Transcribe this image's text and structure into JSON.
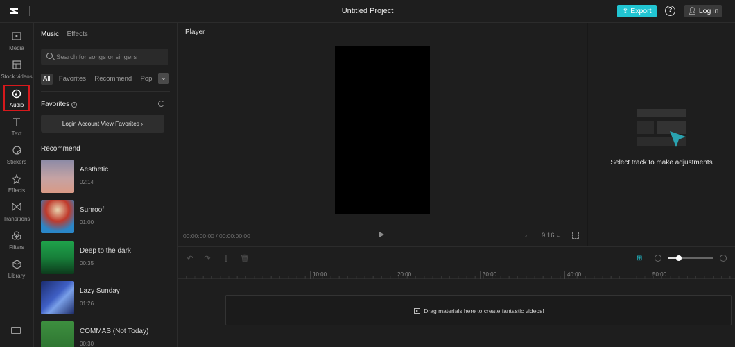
{
  "app": {
    "title": "Untitled Project",
    "logo": "capcut-logo",
    "export_label": "Export",
    "help_label": "?",
    "login_label": "Log in",
    "accent": "#21c5d2",
    "highlight": "#d6191c"
  },
  "sidebar": {
    "items": [
      {
        "label": "Media",
        "icon": "media-icon"
      },
      {
        "label": "Stock videos",
        "icon": "stock-videos-icon"
      },
      {
        "label": "Audio",
        "icon": "audio-icon",
        "active": true
      },
      {
        "label": "Text",
        "icon": "text-icon"
      },
      {
        "label": "Stickers",
        "icon": "stickers-icon"
      },
      {
        "label": "Effects",
        "icon": "effects-icon"
      },
      {
        "label": "Transitions",
        "icon": "transitions-icon"
      },
      {
        "label": "Filters",
        "icon": "filters-icon"
      },
      {
        "label": "Library",
        "icon": "library-icon"
      }
    ],
    "bottom_icon": "keyboard-shortcuts-icon"
  },
  "audio_panel": {
    "tabs": [
      "Music",
      "Effects"
    ],
    "active_tab": "Music",
    "search_placeholder": "Search for songs or singers",
    "filters": [
      "All",
      "Favorites",
      "Recommend",
      "Pop"
    ],
    "active_filter": "All",
    "favorites_title": "Favorites",
    "login_favorites_label": "Login Account View Favorites",
    "recommend_title": "Recommend",
    "songs": [
      {
        "name": "Aesthetic",
        "duration": "02:14"
      },
      {
        "name": "Sunroof",
        "duration": "01:00"
      },
      {
        "name": "Deep to the dark",
        "duration": "00:35"
      },
      {
        "name": "Lazy Sunday",
        "duration": "01:26"
      },
      {
        "name": "COMMAS (Not Today)",
        "duration": "00:30"
      }
    ]
  },
  "player": {
    "title": "Player",
    "timecode": "00:00:00:00 / 00:00:00:00",
    "aspect_ratio": "9:16"
  },
  "adjustments": {
    "message": "Select track to make adjustments"
  },
  "timeline": {
    "ruler_labels": [
      "10:00",
      "20:00",
      "30:00",
      "40:00",
      "50:00"
    ],
    "drop_message": "Drag materials here to create fantastic videos!"
  }
}
